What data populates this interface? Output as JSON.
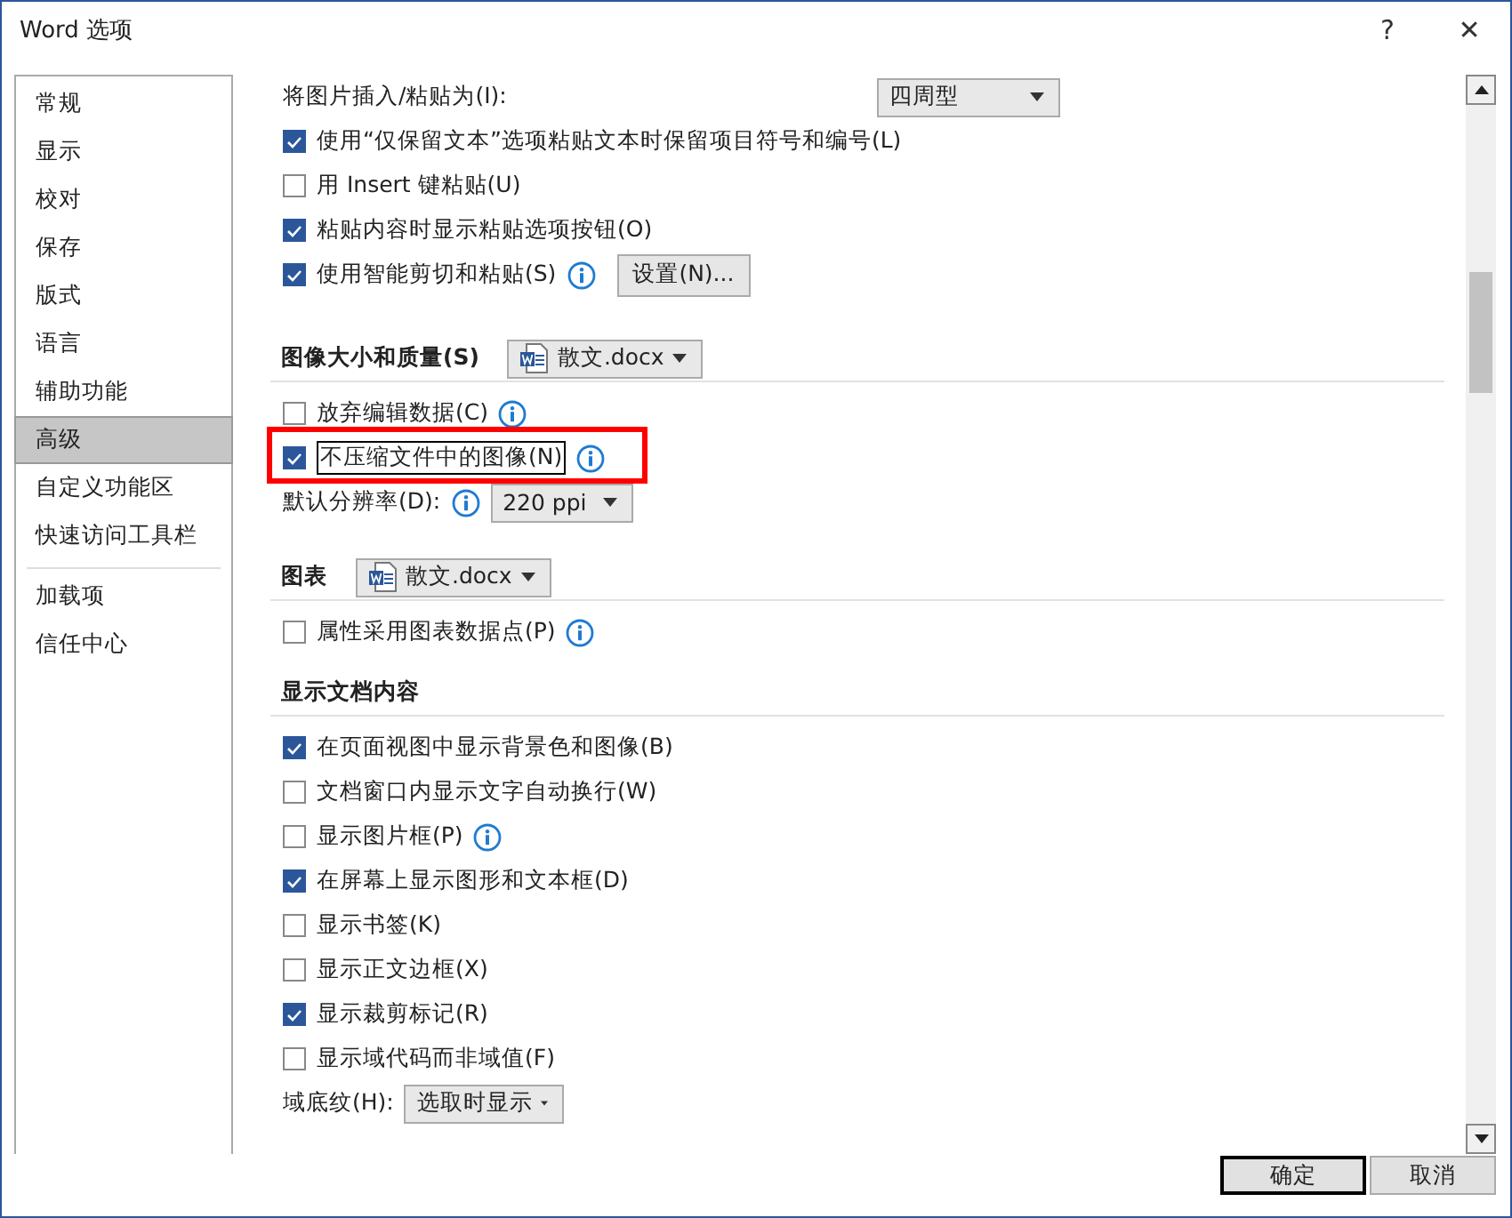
{
  "window": {
    "title": "Word 选项",
    "help": "?",
    "close": "✕"
  },
  "sidebar": {
    "groups": [
      [
        {
          "label": "常规",
          "selected": false
        },
        {
          "label": "显示",
          "selected": false
        },
        {
          "label": "校对",
          "selected": false
        },
        {
          "label": "保存",
          "selected": false
        },
        {
          "label": "版式",
          "selected": false
        },
        {
          "label": "语言",
          "selected": false
        },
        {
          "label": "辅助功能",
          "selected": false
        },
        {
          "label": "高级",
          "selected": true
        },
        {
          "label": "自定义功能区",
          "selected": false
        },
        {
          "label": "快速访问工具栏",
          "selected": false
        }
      ],
      [
        {
          "label": "加载项",
          "selected": false
        },
        {
          "label": "信任中心",
          "selected": false
        }
      ]
    ]
  },
  "content": [
    {
      "kind": "select-right",
      "label": "将图片插入/粘贴为(I):",
      "value": "四周型"
    },
    {
      "kind": "checkbox",
      "label": "使用“仅保留文本”选项粘贴文本时保留项目符号和编号(L)",
      "checked": true
    },
    {
      "kind": "checkbox",
      "label": "用 Insert 键粘贴(U)",
      "checked": false
    },
    {
      "kind": "checkbox",
      "label": "粘贴内容时显示粘贴选项按钮(O)",
      "checked": true
    },
    {
      "kind": "checkbox",
      "label": "使用智能剪切和粘贴(S)",
      "checked": true,
      "info": true,
      "button": "设置(N)..."
    },
    {
      "kind": "section",
      "label": "图像大小和质量(S)",
      "document": "散文.docx"
    },
    {
      "kind": "checkbox",
      "label": "放弃编辑数据(C)",
      "checked": false,
      "info": true
    },
    {
      "kind": "checkbox",
      "label": "不压缩文件中的图像(N)",
      "checked": true,
      "info": true,
      "highlighted": true,
      "focused": true
    },
    {
      "kind": "select",
      "label": "默认分辨率(D):",
      "info": true,
      "value": "220 ppi"
    },
    {
      "kind": "section",
      "label": "图表",
      "document": "散文.docx"
    },
    {
      "kind": "checkbox",
      "label": "属性采用图表数据点(P)",
      "checked": false,
      "info": true
    },
    {
      "kind": "section",
      "label": "显示文档内容"
    },
    {
      "kind": "checkbox",
      "label": "在页面视图中显示背景色和图像(B)",
      "checked": true
    },
    {
      "kind": "checkbox",
      "label": "文档窗口内显示文字自动换行(W)",
      "checked": false
    },
    {
      "kind": "checkbox",
      "label": "显示图片框(P)",
      "checked": false,
      "info": true
    },
    {
      "kind": "checkbox",
      "label": "在屏幕上显示图形和文本框(D)",
      "checked": true
    },
    {
      "kind": "checkbox",
      "label": "显示书签(K)",
      "checked": false
    },
    {
      "kind": "checkbox",
      "label": "显示正文边框(X)",
      "checked": false
    },
    {
      "kind": "checkbox",
      "label": "显示裁剪标记(R)",
      "checked": true
    },
    {
      "kind": "checkbox",
      "label": "显示域代码而非域值(F)",
      "checked": false
    },
    {
      "kind": "select",
      "label": "域底纹(H):",
      "value": "选取时显示"
    }
  ],
  "buttons": [
    {
      "label": "确定",
      "focused": true
    },
    {
      "label": "取消",
      "focused": false
    }
  ]
}
